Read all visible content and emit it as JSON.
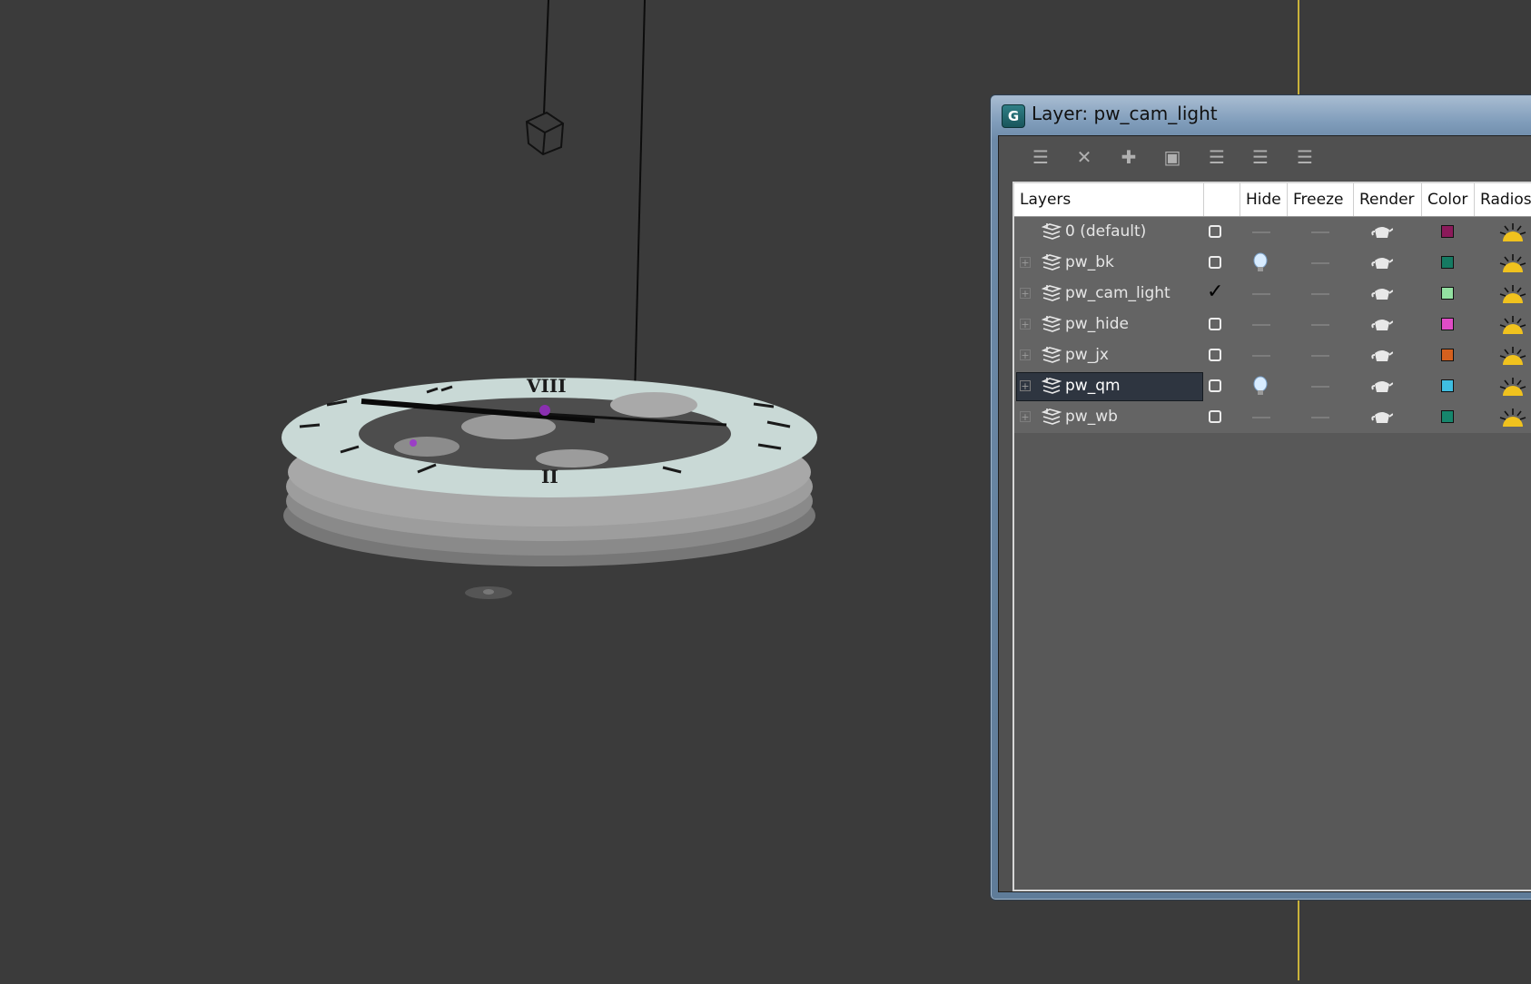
{
  "dialog": {
    "title": "Layer: pw_cam_light",
    "app_icon_glyph": "G"
  },
  "toolbar": {
    "buttons": [
      {
        "icon": "new-layer-icon",
        "glyph": "☰"
      },
      {
        "icon": "delete-icon",
        "glyph": "✕"
      },
      {
        "icon": "add-selected-icon",
        "glyph": "✚"
      },
      {
        "icon": "select-objects-icon",
        "glyph": "▣"
      },
      {
        "icon": "highlight-layer-icon",
        "glyph": "☰"
      },
      {
        "icon": "hide-all-icon",
        "glyph": "☰"
      },
      {
        "icon": "freeze-all-icon",
        "glyph": "☰"
      }
    ]
  },
  "columns": [
    "Layers",
    "",
    "Hide",
    "Freeze",
    "Render",
    "Color",
    "Radios"
  ],
  "layers": [
    {
      "name": "0 (default)",
      "expandable": false,
      "current": false,
      "hidden": false,
      "color": "#8b1a5a",
      "selected": false
    },
    {
      "name": "pw_bk",
      "expandable": true,
      "current": false,
      "hidden": true,
      "color": "#157a62",
      "selected": false
    },
    {
      "name": "pw_cam_light",
      "expandable": true,
      "current": true,
      "hidden": false,
      "color": "#93e0a1",
      "selected": false
    },
    {
      "name": "pw_hide",
      "expandable": true,
      "current": false,
      "hidden": false,
      "color": "#e04cc6",
      "selected": false
    },
    {
      "name": "pw_jx",
      "expandable": true,
      "current": false,
      "hidden": false,
      "color": "#d4601e",
      "selected": false
    },
    {
      "name": "pw_qm",
      "expandable": true,
      "current": false,
      "hidden": true,
      "color": "#3fbde0",
      "selected": true
    },
    {
      "name": "pw_wb",
      "expandable": true,
      "current": false,
      "hidden": false,
      "color": "#16866c",
      "selected": false
    }
  ],
  "viewport": {
    "watch_numerals": [
      "VIII",
      "II"
    ]
  }
}
